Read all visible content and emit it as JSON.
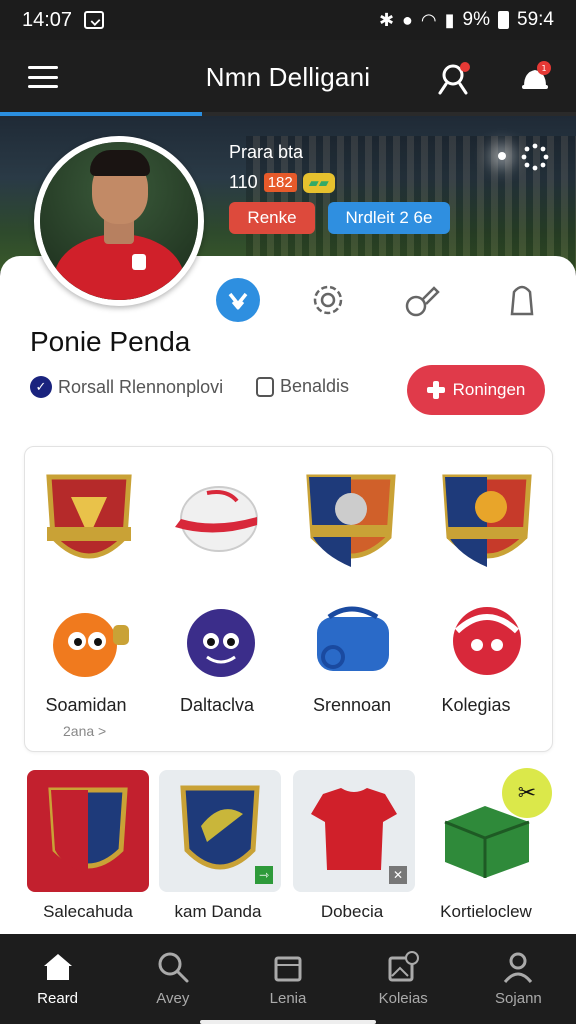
{
  "status_bar": {
    "time": "14:07",
    "battery": "9%",
    "signal_time": "59:4"
  },
  "app_bar": {
    "title": "Nmn Delligani",
    "progress": 0.35
  },
  "hero": {
    "name": "Prara bta",
    "stat_value": "110",
    "stat_badge": "182",
    "btn_primary": "Renke",
    "btn_secondary": "Nrdleit 2 6e"
  },
  "profile": {
    "username": "Ponie Penda",
    "verified_label": "Rorsall Rlennonplovi",
    "lock_label": "Benaldis",
    "action_label": "Roningen"
  },
  "collection": {
    "labels": [
      "Soamidan",
      "Daltaclva",
      "Srennoan",
      "Kolegias"
    ],
    "more": "2ana >"
  },
  "tiles": [
    "Salecahuda",
    "kam Danda",
    "Dobecia",
    "Kortieloclew"
  ],
  "bottom_nav": [
    "Reard",
    "Avey",
    "Lenia",
    "Koleias",
    "Sojann"
  ],
  "colors": {
    "accent": "#2e8fe0",
    "primary_red": "#e03a4a",
    "bar_bg": "#1e1e1e"
  }
}
